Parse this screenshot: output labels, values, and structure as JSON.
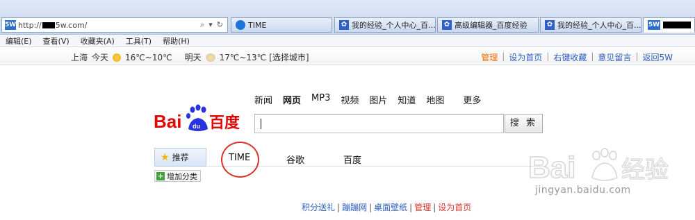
{
  "browser": {
    "address_prefix": "http://",
    "address_suffix": "5w.com/",
    "address_buttons": [
      "⌕",
      "▾",
      "↻"
    ],
    "tabs": [
      {
        "label": "TIME",
        "icon": "globe-icon"
      },
      {
        "label": "我的经验_个人中心_百...",
        "icon": "baidu-paw-icon"
      },
      {
        "label": "高级编辑器_百度经验",
        "icon": "baidu-paw-icon"
      },
      {
        "label": "我的经验_个人中心_百...",
        "icon": "baidu-paw-icon"
      },
      {
        "label": "5W",
        "icon": "site-5w-icon"
      }
    ]
  },
  "menubar": [
    "编辑(E)",
    "查看(V)",
    "收藏夹(A)",
    "工具(T)",
    "帮助(H)"
  ],
  "infobar": {
    "city": "上海",
    "today_label": "今天",
    "today_temp": "16℃~10℃",
    "tomorrow_label": "明天",
    "tomorrow_temp": "17℃~13℃",
    "select_city": "[选择城市]",
    "links": [
      "管理",
      "设为首页",
      "右键收藏",
      "意见留言",
      "返回5W"
    ],
    "separator": "|"
  },
  "baidu": {
    "nav": [
      "新闻",
      "网页",
      "MP3",
      "视频",
      "图片",
      "知道",
      "地图"
    ],
    "nav_more": "更多",
    "search_button": "搜 索",
    "logo_text": "Bai百度"
  },
  "categories": {
    "recommend": "推荐",
    "items": [
      "TIME",
      "谷歌",
      "百度"
    ],
    "add_button": "增加分类"
  },
  "footer": {
    "links": [
      "积分送礼",
      "蹦蹦网",
      "桌面壁纸",
      "管理",
      "设为首页"
    ],
    "separator": "|"
  },
  "watermark": {
    "brand": "Bai经验",
    "url": "jingyan.baidu.com"
  },
  "colors": {
    "baidu_red": "#e10602",
    "baidu_blue": "#2932e1",
    "link_blue": "#2b5fbe",
    "accent_orange": "#f26b00",
    "annotation_red": "#d8342b"
  }
}
